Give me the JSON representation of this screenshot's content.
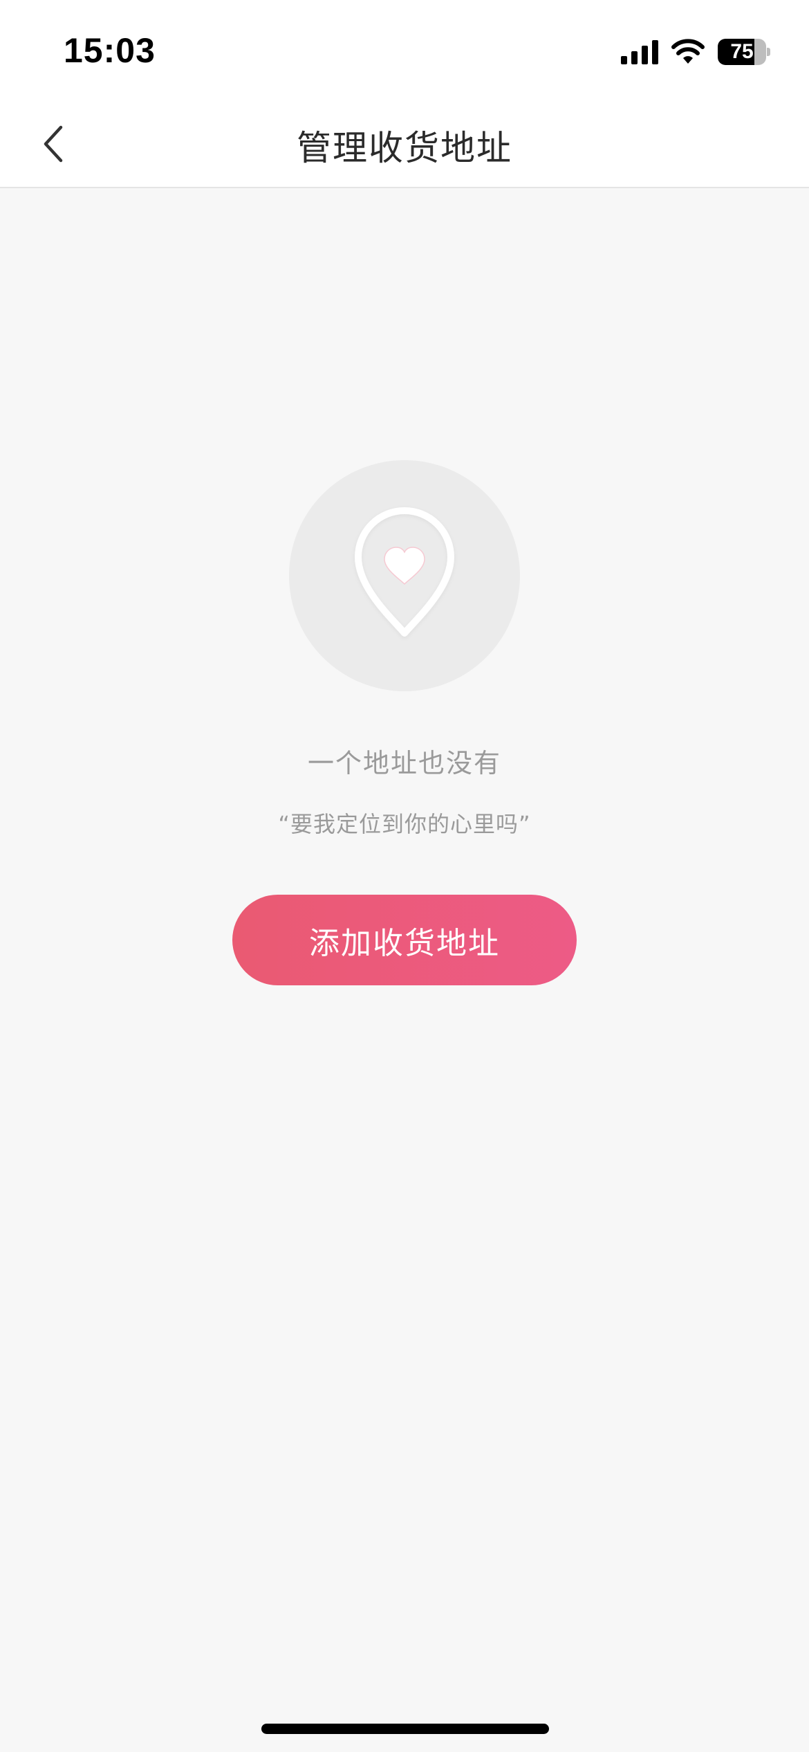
{
  "status_bar": {
    "time": "15:03",
    "battery_level": "75",
    "battery_fraction": 0.75,
    "signal_bars": 4
  },
  "nav": {
    "title": "管理收货地址",
    "back_icon": "chevron-left-icon"
  },
  "empty_state": {
    "icon": "location-pin-heart-icon",
    "title": "一个地址也没有",
    "subtitle": "“要我定位到你的心里吗”",
    "button_label": "添加收货地址"
  },
  "colors": {
    "accent_start": "#ea5a72",
    "accent_end": "#ed5b86",
    "background": "#f7f7f7",
    "muted_text": "#9a9a9a"
  }
}
